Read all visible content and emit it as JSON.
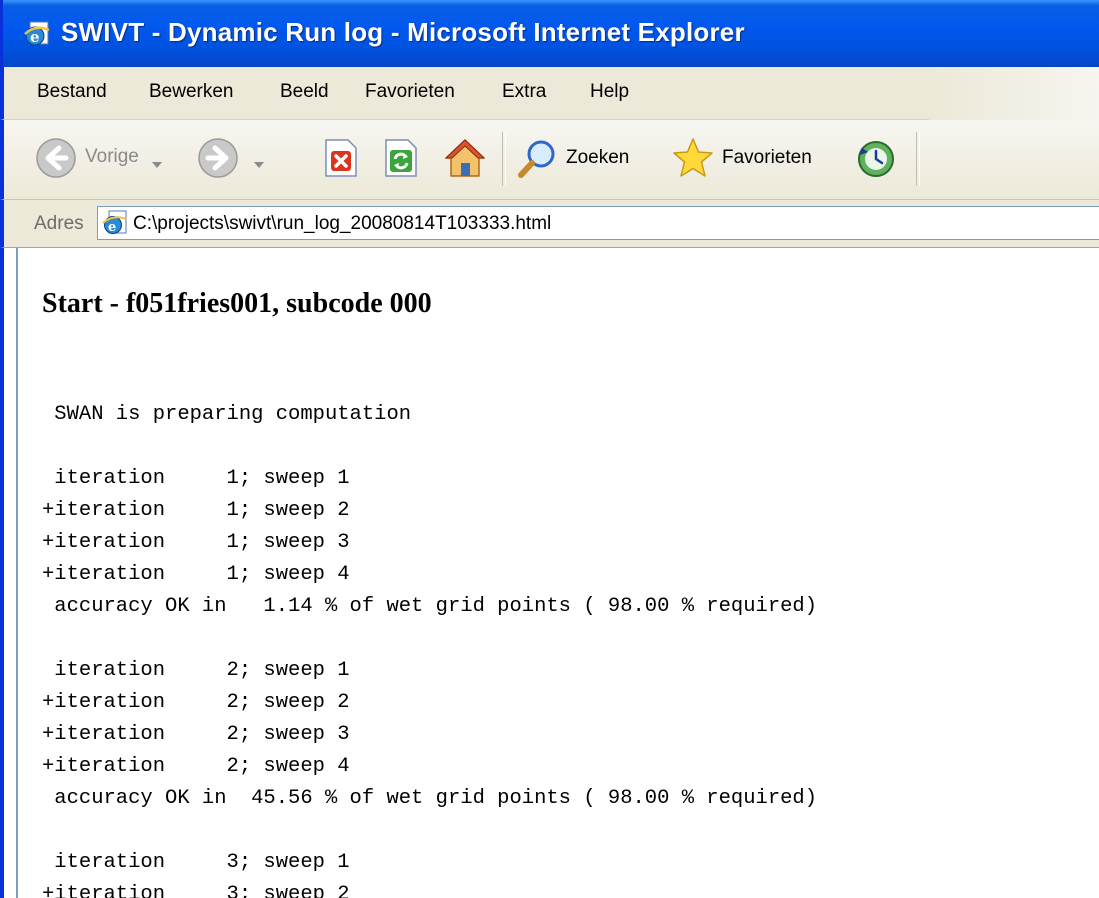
{
  "window": {
    "title": "SWIVT - Dynamic Run log - Microsoft Internet Explorer"
  },
  "menu": {
    "items": [
      "Bestand",
      "Bewerken",
      "Beeld",
      "Favorieten",
      "Extra",
      "Help"
    ]
  },
  "toolbar": {
    "back_label": "Vorige",
    "search_label": "Zoeken",
    "favorites_label": "Favorieten"
  },
  "address": {
    "label": "Adres",
    "url": "C:\\projects\\swivt\\run_log_20080814T103333.html"
  },
  "page": {
    "heading": "Start - f051fries001, subcode 000",
    "log_lines": [
      " SWAN is preparing computation",
      "",
      " iteration     1; sweep 1",
      "+iteration     1; sweep 2",
      "+iteration     1; sweep 3",
      "+iteration     1; sweep 4",
      " accuracy OK in   1.14 % of wet grid points ( 98.00 % required)",
      "",
      " iteration     2; sweep 1",
      "+iteration     2; sweep 2",
      "+iteration     2; sweep 3",
      "+iteration     2; sweep 4",
      " accuracy OK in  45.56 % of wet grid points ( 98.00 % required)",
      "",
      " iteration     3; sweep 1",
      "+iteration     3; sweep 2"
    ]
  }
}
